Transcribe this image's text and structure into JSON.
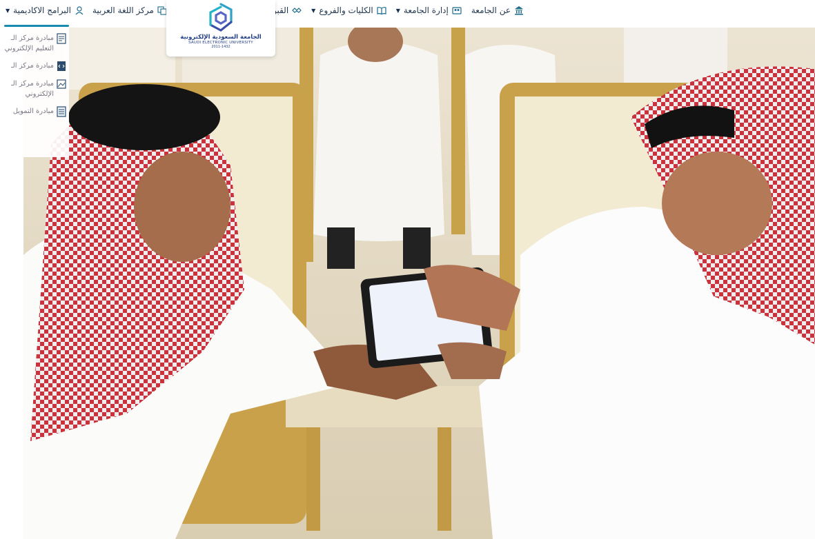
{
  "nav": {
    "items_right": [
      {
        "label": "عن الجامعة",
        "icon": "building-columns-icon",
        "has_caret": false
      },
      {
        "label": "إدارة الجامعة",
        "icon": "people-icon",
        "has_caret": true
      },
      {
        "label": "الكليات والفروع",
        "icon": "open-book-icon",
        "has_caret": true
      },
      {
        "label": "القبول",
        "icon": "handshake-icon",
        "has_caret": false
      }
    ],
    "items_left": [
      {
        "label": "البرامج الاكاديمية",
        "icon": "graduate-icon",
        "has_caret": true
      },
      {
        "label": "مركز اللغة العربية",
        "icon": "language-center-icon",
        "has_caret": false
      }
    ]
  },
  "logo": {
    "name_ar": "الجامعة السعودية الإلكترونية",
    "name_en": "SAUDI ELECTRONIC UNIVERSITY",
    "years": "2011-1432"
  },
  "dropdown": {
    "items": [
      {
        "line1": "مبادرة مركز الـ",
        "line2": "التعليم الإلكتروني",
        "icon": "document-icon"
      },
      {
        "line1": "مبادرة مركز الـ",
        "line2": "",
        "icon": "code-file-icon"
      },
      {
        "line1": "مبادرة مركز الـ",
        "line2": "الإلكتروني",
        "icon": "image-frame-icon"
      },
      {
        "line1": "مبادرة التمويل",
        "line2": "",
        "icon": "ledger-icon"
      }
    ]
  },
  "colors": {
    "accent": "#1a8bb0",
    "text": "#21374f",
    "logo_blue": "#233e87"
  }
}
